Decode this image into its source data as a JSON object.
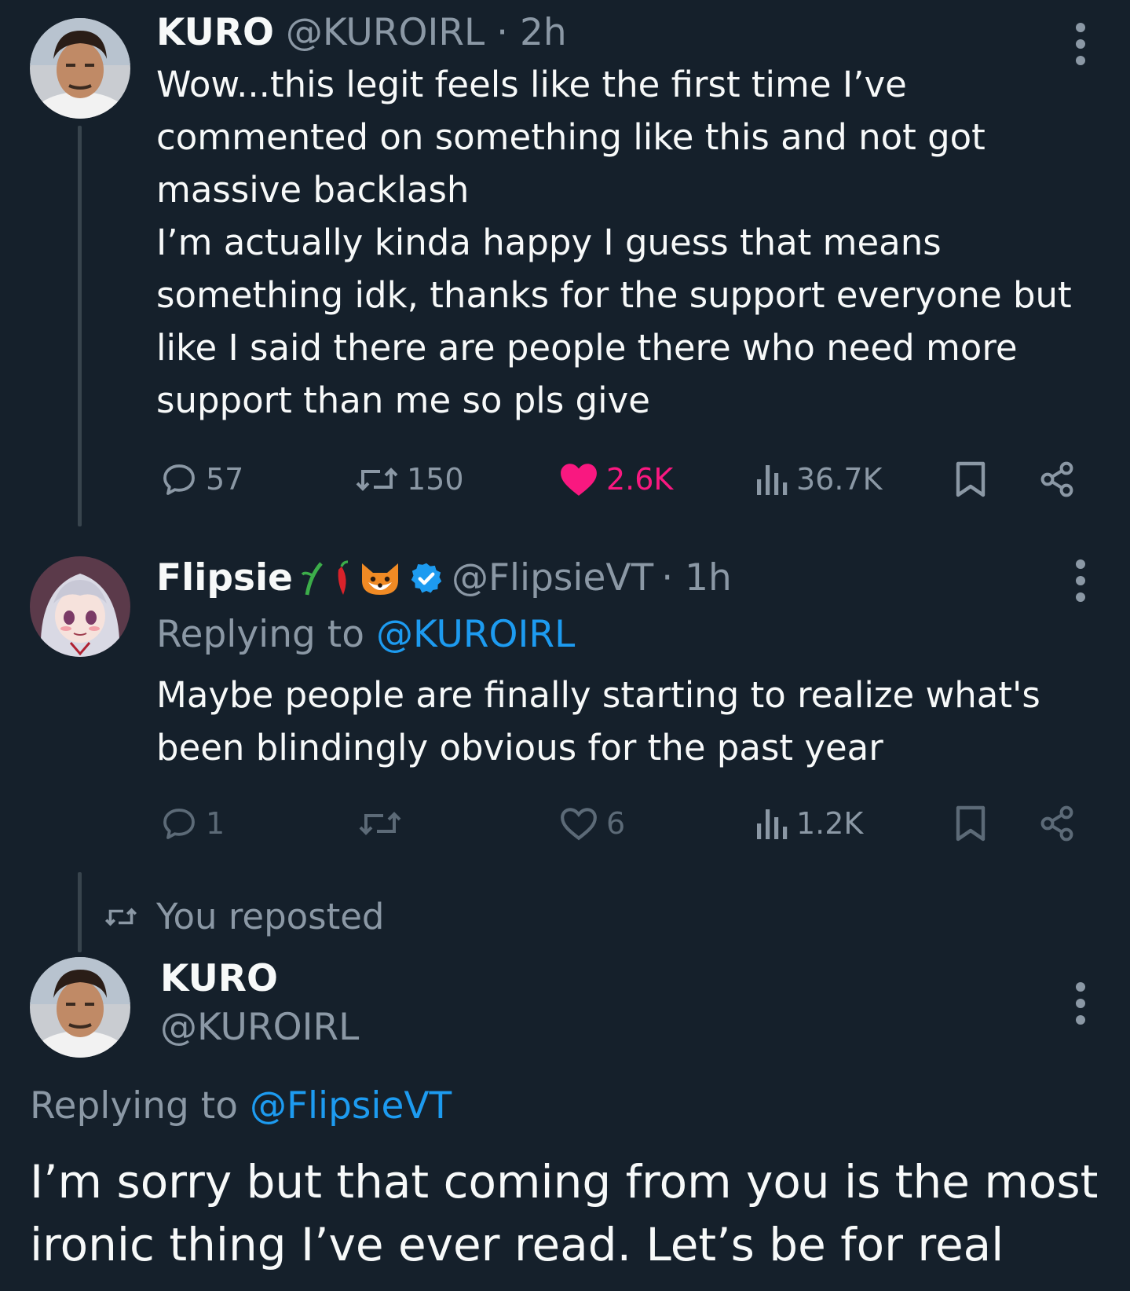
{
  "colors": {
    "background": "#15202b",
    "text": "#f7f9f9",
    "muted": "#8b98a5",
    "link": "#1d9bf0",
    "like_active": "#f91880",
    "thread_line": "#38444d"
  },
  "post1": {
    "display_name": "KURO",
    "handle": "@KUROIRL",
    "time": "· 2h",
    "lines": [
      "Wow...this legit feels like the first time I’ve",
      "commented on something like this and not got",
      "massive backlash",
      "I’m actually kinda happy I guess that means",
      "something idk, thanks for the support everyone but",
      "like I said there are people there who need more",
      "support than me so pls give"
    ],
    "actions": {
      "replies": "57",
      "reposts": "150",
      "likes": "2.6K",
      "views": "36.7K"
    },
    "liked": true
  },
  "post2": {
    "display_name": "Flipsie",
    "emoji_icons": [
      "bamboo-icon",
      "chili-pepper-icon",
      "fox-icon"
    ],
    "verified": true,
    "handle": "@FlipsieVT",
    "time": "· 1h",
    "replying_prefix": "Replying to",
    "replying_to": "@KUROIRL",
    "lines": [
      "Maybe people are finally starting to realize what's",
      "been blindingly obvious for the past year"
    ],
    "actions": {
      "replies": "1",
      "reposts": "",
      "likes": "6",
      "views": "1.2K"
    }
  },
  "post3": {
    "repost_label": "You reposted",
    "display_name": "KURO",
    "handle": "@KUROIRL",
    "replying_prefix": "Replying to",
    "replying_to": "@FlipsieVT",
    "lines": [
      "I’m sorry but that coming from you is the most",
      "ironic thing I’ve ever read. Let’s be for real"
    ]
  }
}
